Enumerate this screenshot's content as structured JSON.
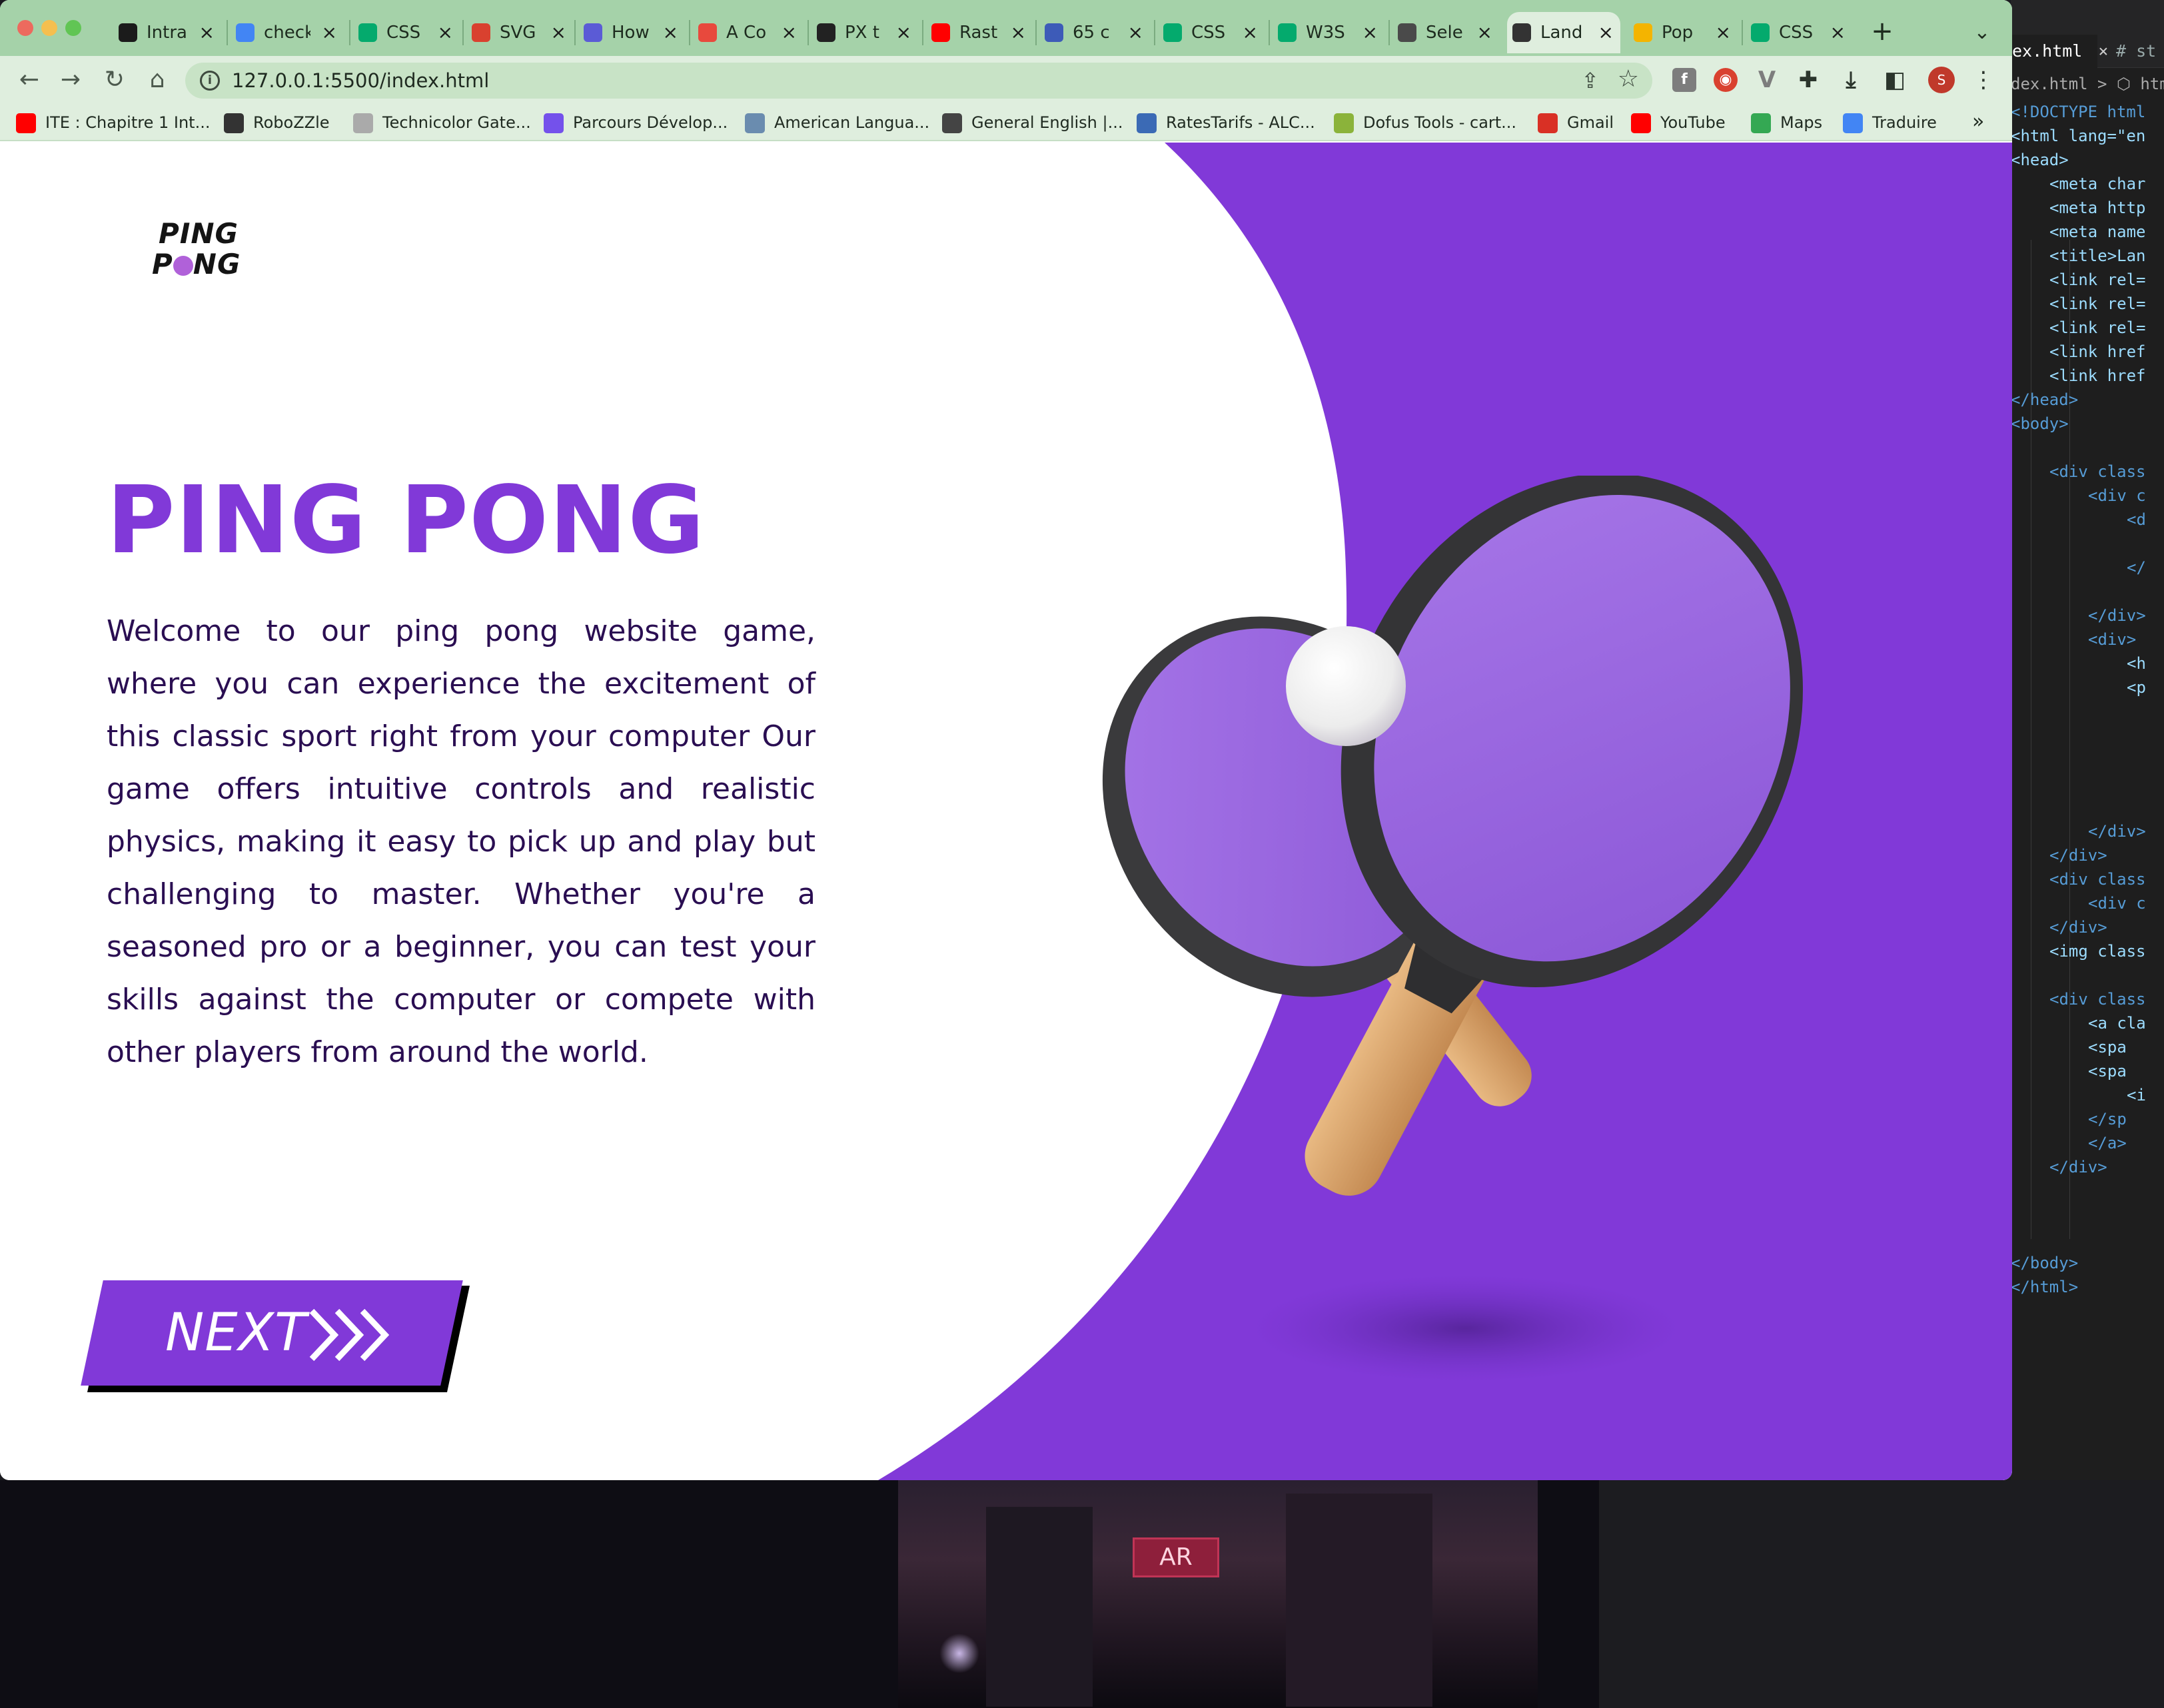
{
  "browser": {
    "tabs": [
      {
        "title": "Intra",
        "icon": "42-icon",
        "color": "#1b1b1b"
      },
      {
        "title": "check",
        "icon": "google-icon",
        "color": "#4285f4"
      },
      {
        "title": "CSS",
        "icon": "w3schools-icon",
        "color": "#04aa6d"
      },
      {
        "title": "SVG",
        "icon": "svg-png-icon",
        "color": "#d9412f"
      },
      {
        "title": "How",
        "icon": "terminal-icon",
        "color": "#5b5bd6"
      },
      {
        "title": "A Co",
        "icon": "asterisk-icon",
        "color": "#e8493d"
      },
      {
        "title": "PX t",
        "icon": "c-icon",
        "color": "#222222"
      },
      {
        "title": "Rast",
        "icon": "youtube-icon",
        "color": "#ff0000"
      },
      {
        "title": "65 c",
        "icon": "wordpress-icon",
        "color": "#3d5bb8"
      },
      {
        "title": "CSS",
        "icon": "w3schools-icon",
        "color": "#04aa6d"
      },
      {
        "title": "W3S",
        "icon": "w3schools-icon",
        "color": "#04aa6d"
      },
      {
        "title": "Sele",
        "icon": "selector-icon",
        "color": "#4a4a4a"
      },
      {
        "title": "Land",
        "icon": "globe-icon",
        "color": "#333333",
        "active": true
      },
      {
        "title": "Pop",
        "icon": "pop-icon",
        "color": "#f4b400"
      },
      {
        "title": "CSS",
        "icon": "w3schools-icon",
        "color": "#04aa6d"
      }
    ],
    "new_tab": "+",
    "tab_menu": "⌄",
    "url": "127.0.0.1:5500/index.html",
    "nav": {
      "back": "←",
      "forward": "→",
      "reload": "↻",
      "home": "⌂"
    },
    "profile_initial": "S",
    "bookmarks": [
      {
        "label": "ITE : Chapitre 1 Int...",
        "icon": "youtube-icon",
        "color": "#ff0000"
      },
      {
        "label": "RoboZZle",
        "icon": "robozzle-icon",
        "color": "#333333"
      },
      {
        "label": "Technicolor Gate...",
        "icon": "technicolor-icon",
        "color": "#aaaaaa"
      },
      {
        "label": "Parcours Dévelop...",
        "icon": "openclassrooms-icon",
        "color": "#7451eb"
      },
      {
        "label": "American Langua...",
        "icon": "gear-badge-icon",
        "color": "#6a8caf"
      },
      {
        "label": "General English |...",
        "icon": "clover-icon",
        "color": "#444444"
      },
      {
        "label": "RatesTarifs - ALC...",
        "icon": "star-badge-icon",
        "color": "#3b6ab5"
      },
      {
        "label": "Dofus Tools - cart...",
        "icon": "dofus-icon",
        "color": "#8bb33a"
      },
      {
        "label": "Gmail",
        "icon": "gmail-icon",
        "color": "#d93025"
      },
      {
        "label": "YouTube",
        "icon": "youtube-icon",
        "color": "#ff0000"
      },
      {
        "label": "Maps",
        "icon": "maps-icon",
        "color": "#34a853"
      },
      {
        "label": "Traduire",
        "icon": "translate-icon",
        "color": "#4285f4"
      }
    ],
    "bookmarks_more": "»"
  },
  "page": {
    "logo": {
      "line1": "PING",
      "line2_a": "P",
      "line2_b": "NG"
    },
    "title": "PING PONG",
    "description": "Welcome to our ping pong website game, where you can experience the excitement of this classic sport right from your computer Our game offers intuitive controls and realistic physics, making it easy to pick up and play but challenging to master. Whether you're a seasoned pro or a beginner, you can test your skills against the computer or compete with other players from around the world.",
    "next_label": "NEXT",
    "colors": {
      "primary": "#8139d8",
      "text": "#2a0e52",
      "paddle": "#9b6ae0",
      "handle": "#d9a56c"
    }
  },
  "editor": {
    "active_tab": "ex.html",
    "tab_close": "×",
    "tab2": "# st",
    "breadcrumb": "dex.html > ⬡ html",
    "lines": [
      "<!DOCTYPE html",
      "<html lang=\"en",
      "<head>",
      "<meta char",
      "<meta http",
      "<meta name",
      "<title>Lan",
      "<link rel=",
      "<link rel=",
      "<link rel=",
      "<link href",
      "<link href",
      "</head>",
      "<body>",
      "",
      "<div class",
      "<div c",
      "<d",
      "",
      "</",
      "",
      "</div>",
      "<div>",
      "<h",
      "<p",
      "",
      "",
      "",
      "",
      "",
      "</div>",
      "</div>",
      "<div class",
      "<div c",
      "</div>",
      "<img class",
      "",
      "<div class",
      "<a cla",
      "<spa",
      "<spa",
      "<i",
      "</sp",
      "</a>",
      "</div>",
      "",
      "",
      "",
      "</body>",
      "</html>"
    ]
  },
  "desktop": {
    "sign_text": "AR"
  }
}
